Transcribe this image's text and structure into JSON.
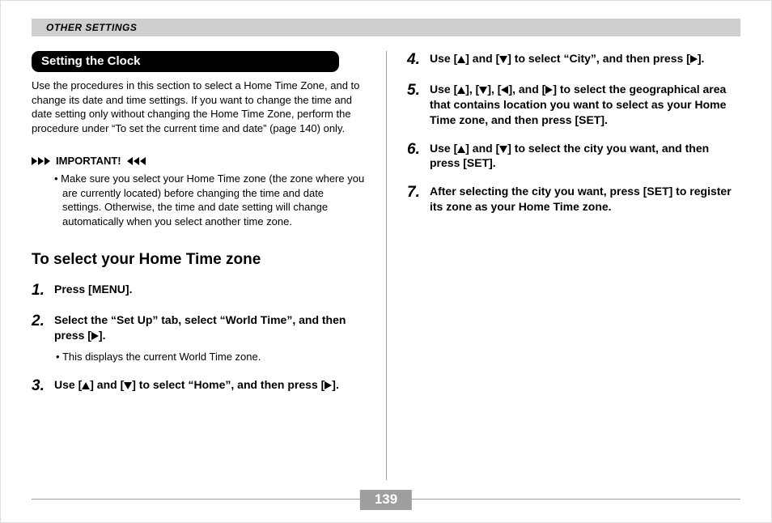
{
  "header": {
    "section": "OTHER SETTINGS"
  },
  "heading": "Setting the Clock",
  "intro": "Use the procedures in this section to select a Home Time Zone, and to change its date and time settings. If you want to change the time and date setting only without changing the Home Time Zone, perform the procedure under “To set the current time and date” (page 140) only.",
  "important": {
    "label": "IMPORTANT!",
    "bullet": "Make sure you select your Home Time zone (the zone where you are currently located) before changing the time and date settings. Otherwise, the time and date setting will change automatically when you select another time zone."
  },
  "subhead": "To select your Home Time zone",
  "steps": {
    "s1": {
      "num": "1.",
      "text": "Press [MENU]."
    },
    "s2": {
      "num": "2.",
      "pre": "Select the “Set Up” tab, select “World Time”, and then press [",
      "post": "].",
      "sub": "This displays the current World Time zone."
    },
    "s3": {
      "num": "3.",
      "a": "Use [",
      "b": "] and [",
      "c": "] to select “Home”, and then press [",
      "d": "]."
    },
    "s4": {
      "num": "4.",
      "a": "Use [",
      "b": "] and [",
      "c": "] to select “City”, and then press [",
      "d": "]."
    },
    "s5": {
      "num": "5.",
      "a": "Use [",
      "b": "], [",
      "c": "], [",
      "d": "], and [",
      "e": "] to select the geographical area that contains location you want to select as your Home Time zone, and then press [SET]."
    },
    "s6": {
      "num": "6.",
      "a": "Use [",
      "b": "] and [",
      "c": "] to select the city you want, and then press [SET]."
    },
    "s7": {
      "num": "7.",
      "text": "After selecting the city you want, press [SET] to register its zone as your Home Time zone."
    }
  },
  "pageNumber": "139"
}
